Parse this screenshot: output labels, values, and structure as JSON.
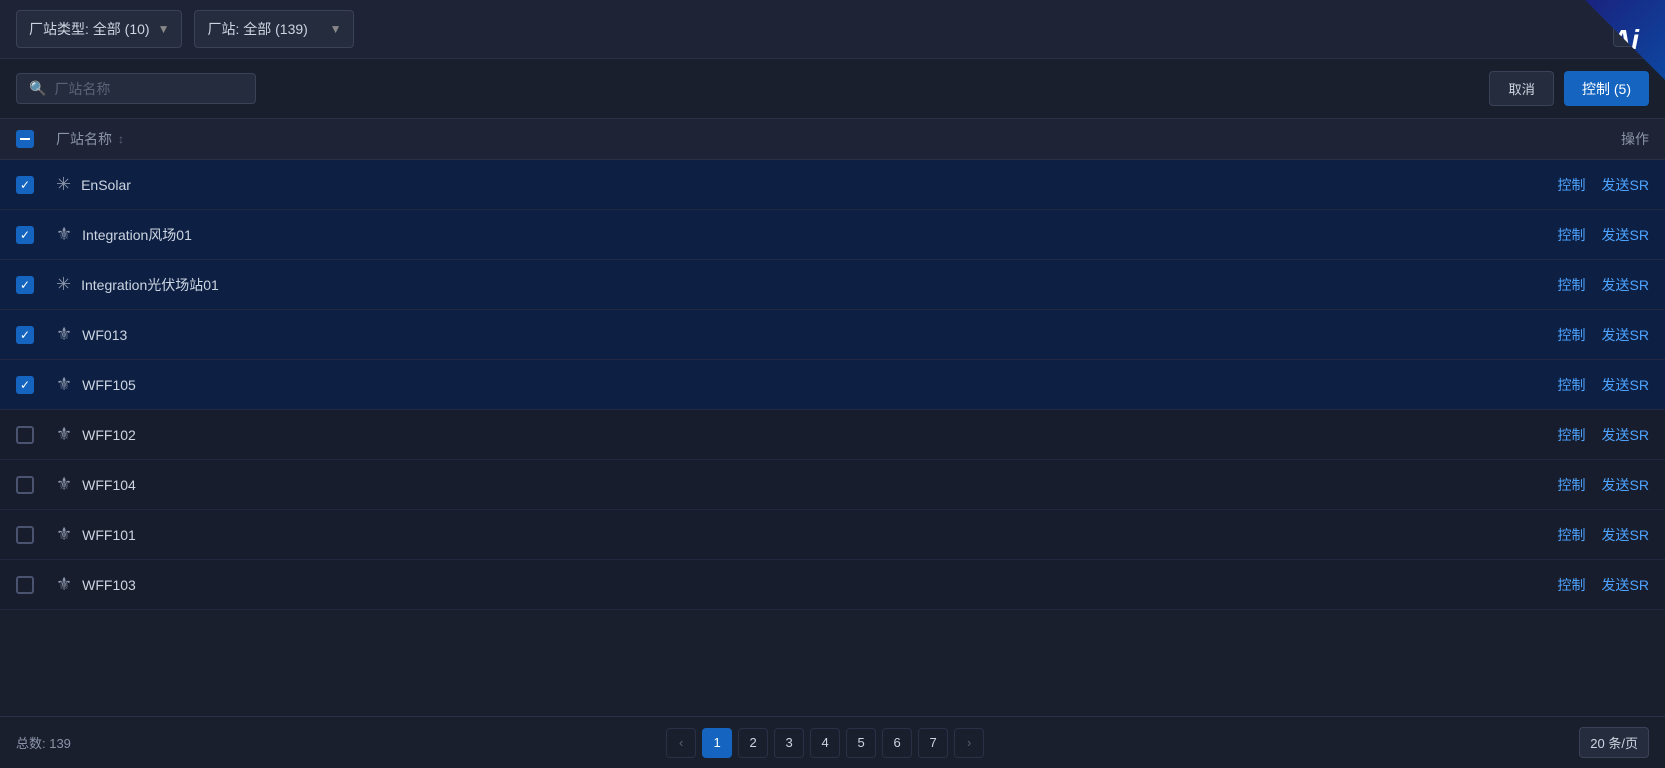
{
  "topbar": {
    "filter1_label": "厂站类型: 全部 (10)",
    "filter2_label": "厂站: 全部 (139)",
    "export_icon": "export-icon"
  },
  "search": {
    "placeholder": "厂站名称",
    "cancel_label": "取消",
    "control_label": "控制 (5)"
  },
  "table": {
    "col_name": "厂站名称",
    "col_sort_icon": "↕",
    "col_ops": "操作"
  },
  "rows": [
    {
      "id": 1,
      "name": "EnSolar",
      "checked": true,
      "icon_type": "solar",
      "control": "控制",
      "send_sr": "发送SR"
    },
    {
      "id": 2,
      "name": "Integration风场01",
      "checked": true,
      "icon_type": "wind",
      "control": "控制",
      "send_sr": "发送SR"
    },
    {
      "id": 3,
      "name": "Integration光伏场站01",
      "checked": true,
      "icon_type": "solar",
      "control": "控制",
      "send_sr": "发送SR"
    },
    {
      "id": 4,
      "name": "WF013",
      "checked": true,
      "icon_type": "wind",
      "control": "控制",
      "send_sr": "发送SR"
    },
    {
      "id": 5,
      "name": "WFF105",
      "checked": true,
      "icon_type": "wind",
      "control": "控制",
      "send_sr": "发送SR"
    },
    {
      "id": 6,
      "name": "WFF102",
      "checked": false,
      "icon_type": "wind",
      "control": "控制",
      "send_sr": "发送SR"
    },
    {
      "id": 7,
      "name": "WFF104",
      "checked": false,
      "icon_type": "wind",
      "control": "控制",
      "send_sr": "发送SR"
    },
    {
      "id": 8,
      "name": "WFF101",
      "checked": false,
      "icon_type": "wind",
      "control": "控制",
      "send_sr": "发送SR"
    },
    {
      "id": 9,
      "name": "WFF103",
      "checked": false,
      "icon_type": "wind",
      "control": "控制",
      "send_sr": "发送SR"
    }
  ],
  "footer": {
    "total_label": "总数: 139",
    "pages": [
      "1",
      "2",
      "3",
      "4",
      "5",
      "6",
      "7"
    ],
    "per_page": "20 条/页",
    "prev_icon": "‹",
    "next_icon": "›"
  },
  "ai_badge": {
    "text": "Ai"
  }
}
